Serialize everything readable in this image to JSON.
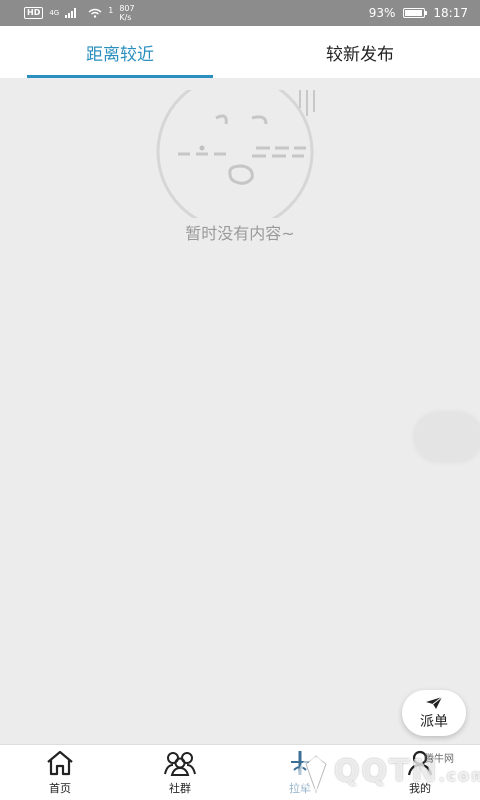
{
  "status_bar": {
    "hd": "HD",
    "network": "4G",
    "wifi_sub": "1",
    "speed_value": "807",
    "speed_unit": "K/s",
    "battery": "93%",
    "time": "18:17",
    "battery_level_percent": 93
  },
  "tabs": [
    {
      "label": "距离较近",
      "active": true
    },
    {
      "label": "较新发布",
      "active": false
    }
  ],
  "empty_state": {
    "message": "暂时没有内容~",
    "icon": "sleepy-face-icon"
  },
  "fab": {
    "label": "派单",
    "icon": "paper-plane-icon"
  },
  "bottom_nav": [
    {
      "label": "首页",
      "icon": "home-icon"
    },
    {
      "label": "社群",
      "icon": "group-icon"
    },
    {
      "label": "拉单",
      "icon": "order-icon"
    },
    {
      "label": "我的",
      "icon": "profile-icon"
    }
  ],
  "watermark": {
    "text": "QQTN",
    "suffix": ".com",
    "small": "腾牛网"
  },
  "colors": {
    "accent": "#2a8fbf",
    "background": "#ececec",
    "status_bar": "#8c8c8c"
  }
}
